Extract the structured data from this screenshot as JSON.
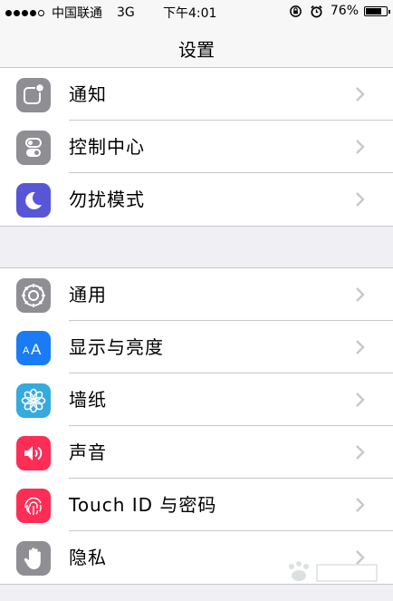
{
  "status_bar": {
    "carrier": "中国联通",
    "network": "3G",
    "time": "下午4:01",
    "battery": "76%",
    "battery_level": 0.76
  },
  "nav": {
    "title": "设置"
  },
  "groups": [
    {
      "items": [
        {
          "label": "通知",
          "icon": "notifications-icon",
          "color": "#8e8e93"
        },
        {
          "label": "控制中心",
          "icon": "control-center-icon",
          "color": "#8e8e93"
        },
        {
          "label": "勿扰模式",
          "icon": "do-not-disturb-icon",
          "color": "#5856d6"
        }
      ]
    },
    {
      "items": [
        {
          "label": "通用",
          "icon": "gear-icon",
          "color": "#8e8e93"
        },
        {
          "label": "显示与亮度",
          "icon": "display-brightness-icon",
          "color": "#1a7cf5"
        },
        {
          "label": "墙纸",
          "icon": "wallpaper-icon",
          "color": "#36aadc"
        },
        {
          "label": "声音",
          "icon": "sound-icon",
          "color": "#fe2d55"
        },
        {
          "label": "Touch ID 与密码",
          "icon": "touch-id-icon",
          "color": "#fe2d55"
        },
        {
          "label": "隐私",
          "icon": "privacy-hand-icon",
          "color": "#8e8e93"
        }
      ]
    }
  ]
}
